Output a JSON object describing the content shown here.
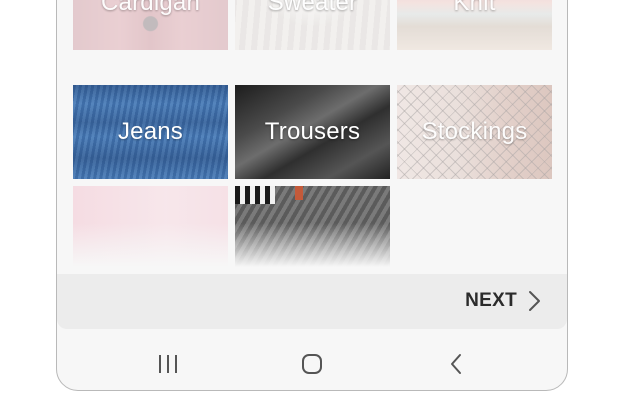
{
  "categories": {
    "row1": [
      {
        "label": "Cardigan",
        "faded": true
      },
      {
        "label": "Sweater",
        "faded": true
      },
      {
        "label": "Knit",
        "faded": true
      }
    ],
    "row2": [
      {
        "label": "Jeans",
        "faded": false
      },
      {
        "label": "Trousers",
        "faded": false
      },
      {
        "label": "Stockings",
        "faded": true
      }
    ],
    "row3": [
      {
        "label": "",
        "faded": true
      },
      {
        "label": "",
        "faded": false
      }
    ]
  },
  "action_bar": {
    "next_label": "NEXT",
    "next_icon": "chevron-right-icon"
  },
  "navigation": {
    "recent_apps_icon": "recent-apps-icon",
    "home_icon": "home-icon",
    "back_icon": "back-icon"
  },
  "colors": {
    "frame_bg": "#f7f7f7",
    "action_bar_bg": "#ececec",
    "next_text": "#2b2b2b",
    "nav_icon": "#555555",
    "label_text": "#ffffff"
  }
}
